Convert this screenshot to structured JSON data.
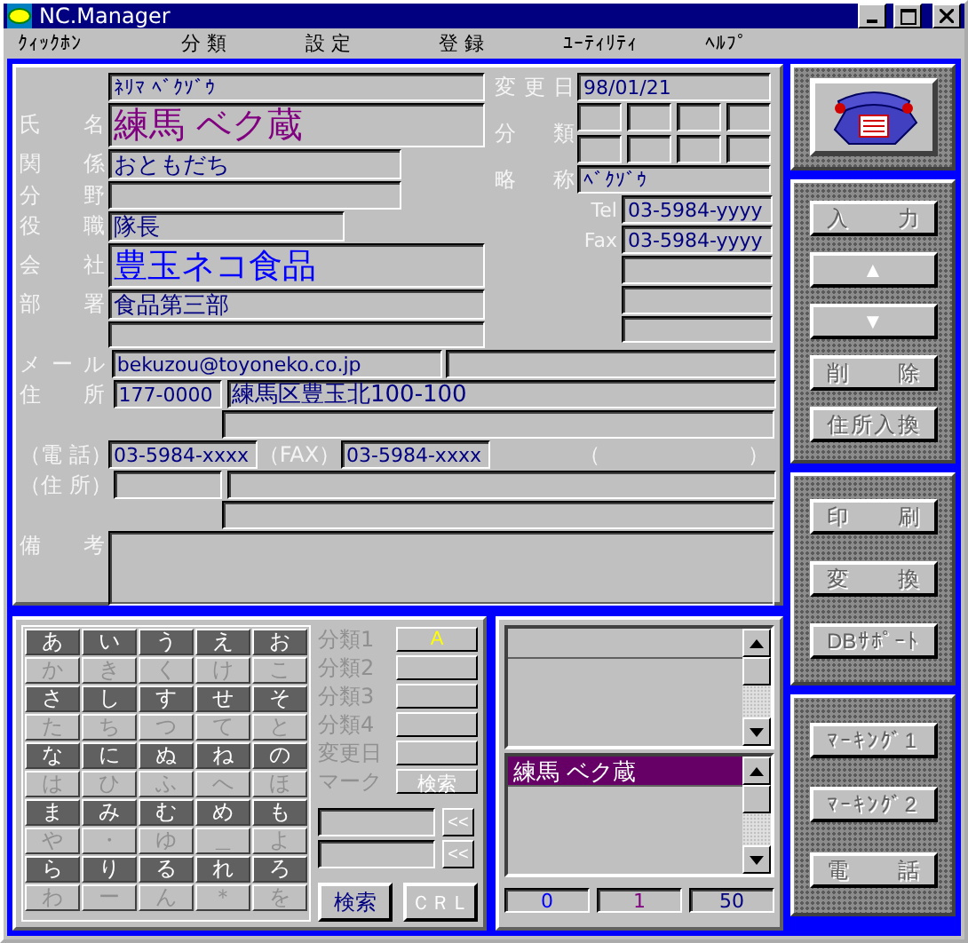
{
  "window": {
    "title": "NC.Manager"
  },
  "menu": [
    "ｸｨｯｸﾎﾝ",
    "分 類",
    "設 定",
    "登 録",
    "ﾕｰﾃｨﾘﾃｨ",
    "ﾍﾙﾌﾟ"
  ],
  "card": {
    "reading": "ﾈﾘﾏ ﾍﾞｸｿﾞｳ",
    "name_label": "氏 名",
    "name": "練馬 ベク蔵",
    "relation_label": "関 係",
    "relation": "おともだち",
    "field_label": "分 野",
    "position_label": "役 職",
    "position": "隊長",
    "company_label": "会 社",
    "company": "豊玉ネコ食品",
    "dept_label": "部 署",
    "dept": "食品第三部",
    "changed_label": "変更日",
    "changed": "98/01/21",
    "category_label": "分 類",
    "short_label": "略 称",
    "short": "ﾍﾞｸｿﾞｳ",
    "tel_label": "Tel",
    "tel": "03-5984-yyyy",
    "fax_label": "Fax",
    "fax": "03-5984-yyyy",
    "mail_label": "メ ー ル",
    "mail": "bekuzou@toyoneko.co.jp",
    "address_label": "住 所",
    "postal": "177-0000",
    "address": "練馬区豊玉北100-100",
    "phone2_label": "（電 話）",
    "phone2": "03-5984-xxxx",
    "fax2_label": "（FAX）",
    "fax2": "03-5984-xxxx",
    "paren_open": "（",
    "paren_close": "）",
    "address2_label": "（住 所）",
    "note_label": "備 考"
  },
  "side_panels": [
    {
      "buttons": [
        {
          "kind": "phone"
        }
      ]
    },
    {
      "buttons": [
        {
          "kind": "text",
          "label": "入 力"
        },
        {
          "kind": "arrow",
          "label": "▲"
        },
        {
          "kind": "arrow",
          "label": "▼"
        },
        {
          "kind": "text",
          "label": "削 除"
        },
        {
          "kind": "text",
          "label": "住所入換"
        }
      ]
    },
    {
      "buttons": [
        {
          "kind": "text",
          "label": "印 刷"
        },
        {
          "kind": "text",
          "label": "変 換"
        },
        {
          "kind": "text",
          "label": "DBｻﾎﾟｰﾄ"
        }
      ]
    },
    {
      "buttons": [
        {
          "kind": "text",
          "label": "ﾏｰｷﾝｸﾞ1"
        },
        {
          "kind": "text",
          "label": "ﾏｰｷﾝｸﾞ2"
        },
        {
          "kind": "text",
          "label": "電 話"
        }
      ]
    }
  ],
  "kana": [
    [
      "あ",
      "い",
      "う",
      "え",
      "お"
    ],
    [
      "か",
      "き",
      "く",
      "け",
      "こ"
    ],
    [
      "さ",
      "し",
      "す",
      "せ",
      "そ"
    ],
    [
      "た",
      "ち",
      "つ",
      "て",
      "と"
    ],
    [
      "な",
      "に",
      "ぬ",
      "ね",
      "の"
    ],
    [
      "は",
      "ひ",
      "ふ",
      "へ",
      "ほ"
    ],
    [
      "ま",
      "み",
      "む",
      "め",
      "も"
    ],
    [
      "や",
      "・",
      "ゆ",
      "＿",
      "よ"
    ],
    [
      "ら",
      "り",
      "る",
      "れ",
      "ろ"
    ],
    [
      "わ",
      "ー",
      "ん",
      "＊",
      "を"
    ]
  ],
  "filters": [
    {
      "label": "分類1",
      "value": "A"
    },
    {
      "label": "分類2"
    },
    {
      "label": "分類3"
    },
    {
      "label": "分類4"
    },
    {
      "label": "変更日"
    },
    {
      "label": "マーク",
      "button": "検索"
    }
  ],
  "extra_inputs": [
    {
      "button": "<<"
    },
    {
      "button": "<<"
    }
  ],
  "search_button": "検索",
  "clear_button": "ＣＲＬ",
  "results": [
    {
      "text": "練馬 ベク蔵",
      "selected": true
    }
  ],
  "counts": [
    {
      "text": "0",
      "color": "#0000ff"
    },
    {
      "text": "1",
      "color": "#800080"
    },
    {
      "text": "50",
      "color": "#000080"
    }
  ]
}
